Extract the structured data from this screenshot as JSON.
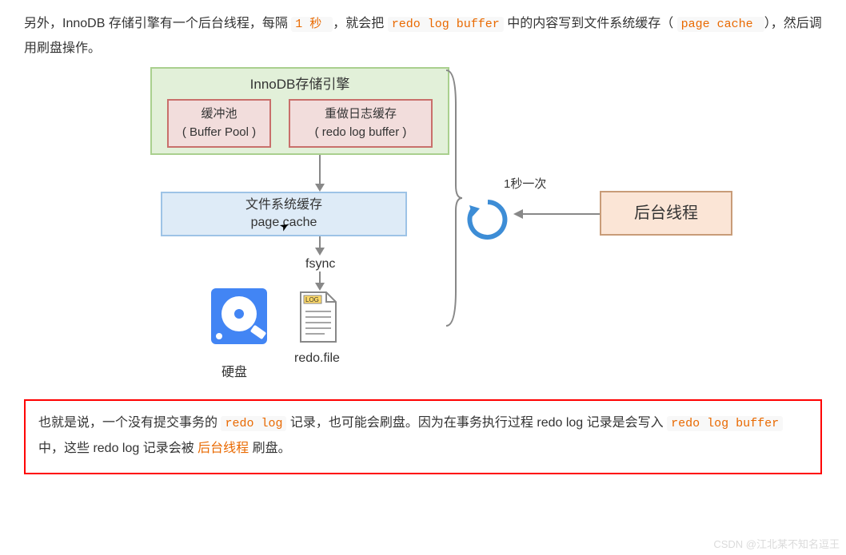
{
  "para1_1": "另外，InnoDB 存储引擎有一个后台线程，每隔 ",
  "para1_code1": "1 秒 ",
  "para1_2": "，就会把 ",
  "para1_code2": "redo log buffer",
  "para1_3": " 中的内容写到文件系统缓存（ ",
  "para1_code3": "page cache ",
  "para1_4": "），然后调用刷盘操作。",
  "diagram": {
    "innodb_title": "InnoDB存储引擎",
    "buffer_pool_l1": "缓冲池",
    "buffer_pool_l2": "( Buffer Pool )",
    "redo_buffer_l1": "重做日志缓存",
    "redo_buffer_l2": "( redo log buffer )",
    "page_cache_l1": "文件系统缓存",
    "page_cache_l2": "page cache",
    "fsync": "fsync",
    "disk": "硬盘",
    "redo_file": "redo.file",
    "spinner_label": "1秒一次",
    "bg_thread": "后台线程",
    "log_tab": "LOG"
  },
  "box_1": "也就是说，一个没有提交事务的 ",
  "box_code1": "redo log",
  "box_2": " 记录，也可能会刷盘。因为在事务执行过程 redo log 记录是会写入",
  "box_code2": "redo log buffer",
  "box_3": " 中，这些 redo log 记录会被 ",
  "box_bgthread": "后台线程",
  "box_4": " 刷盘。",
  "watermark": "CSDN @江北某不知名逗王"
}
